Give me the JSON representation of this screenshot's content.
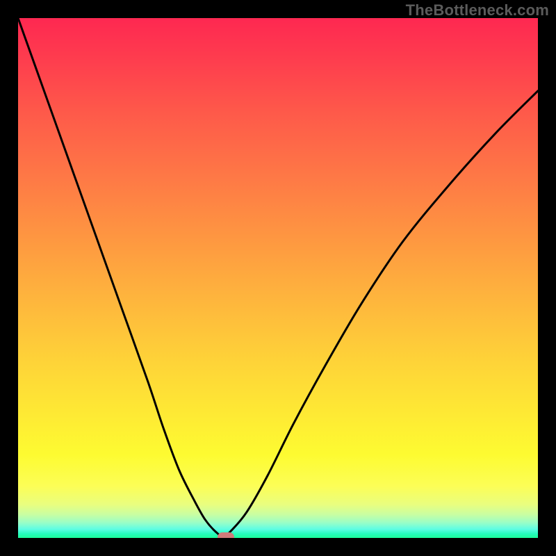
{
  "watermark": "TheBottleneck.com",
  "colors": {
    "curve": "#000000",
    "marker": "#cf7a7a",
    "frame_bg": "#000000"
  },
  "chart_data": {
    "type": "line",
    "title": "",
    "xlabel": "",
    "ylabel": "",
    "xlim": [
      0,
      100
    ],
    "ylim": [
      0,
      100
    ],
    "grid": false,
    "series": [
      {
        "name": "bottleneck-curve",
        "x": [
          0,
          5,
          10,
          15,
          20,
          25,
          28,
          31,
          34,
          36,
          38,
          39.5,
          41,
          44,
          48,
          53,
          59,
          66,
          74,
          83,
          92,
          100
        ],
        "values": [
          100,
          86,
          72,
          58,
          44,
          30,
          21,
          13,
          7,
          3.5,
          1.2,
          0.3,
          1.4,
          5,
          12,
          22,
          33,
          45,
          57,
          68,
          78,
          86
        ]
      }
    ],
    "annotations": [
      {
        "name": "optimal-point",
        "x": 40,
        "y": 0.2
      }
    ],
    "background_gradient": {
      "direction": "vertical",
      "stops": [
        {
          "pos": 0.0,
          "color": "#fe2851"
        },
        {
          "pos": 0.4,
          "color": "#fe9641"
        },
        {
          "pos": 0.8,
          "color": "#fdfb31"
        },
        {
          "pos": 0.96,
          "color": "#c9fea2"
        },
        {
          "pos": 1.0,
          "color": "#1dfc9a"
        }
      ]
    }
  }
}
